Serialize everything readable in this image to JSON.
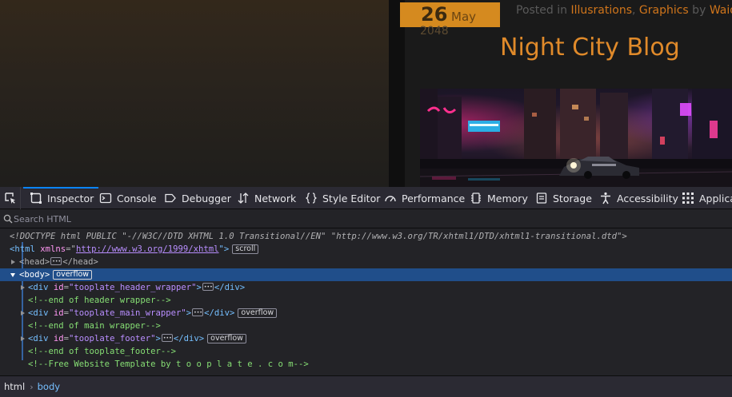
{
  "page": {
    "date_day": "26",
    "date_month": "May",
    "date_year": "2048",
    "meta_prefix": "Posted in ",
    "meta_cat1": "Illusrations",
    "meta_sep": ", ",
    "meta_cat2": "Graphics",
    "meta_by": " by ",
    "meta_author": "Waidroc",
    "blog_title": "Night City Blog",
    "hero_image_alt": "cyberpunk night city street with car and neon signs"
  },
  "devtools": {
    "tabs": [
      {
        "label": "Inspector",
        "icon": "inspector-icon",
        "active": true
      },
      {
        "label": "Console",
        "icon": "console-icon"
      },
      {
        "label": "Debugger",
        "icon": "debugger-icon"
      },
      {
        "label": "Network",
        "icon": "network-icon"
      },
      {
        "label": "Style Editor",
        "icon": "style-editor-icon"
      },
      {
        "label": "Performance",
        "icon": "performance-icon"
      },
      {
        "label": "Memory",
        "icon": "memory-icon"
      },
      {
        "label": "Storage",
        "icon": "storage-icon"
      },
      {
        "label": "Accessibility",
        "icon": "accessibility-icon"
      },
      {
        "label": "Applica",
        "icon": "application-icon"
      }
    ],
    "search_placeholder": "Search HTML",
    "markup": {
      "doctype": "<!DOCTYPE html PUBLIC \"-//W3C//DTD XHTML 1.0 Transitional//EN\" \"http://www.w3.org/TR/xhtml1/DTD/xhtml1-transitional.dtd\">",
      "html_open": "<html ",
      "html_attr": "xmlns",
      "html_eq": "=\"",
      "html_val": "http://www.w3.org/1999/xhtml",
      "html_close": "\">",
      "html_badge": "scroll",
      "head_open": "<head>",
      "head_close": "</head>",
      "body_tag": "<body>",
      "body_badge": "overflow",
      "div_open": "<div ",
      "id_attr": "id",
      "div1_id": "\"tooplate_header_wrapper\"",
      "gt": ">",
      "div_close": "</div>",
      "comment1": "<!--end of header wrapper-->",
      "div2_id": "\"tooplate_main_wrapper\"",
      "div2_badge": "overflow",
      "comment2": "<!--end of main wrapper-->",
      "div3_id": "\"tooplate_footer\"",
      "div3_badge": "overflow",
      "comment3": "<!--end of tooplate_footer-->",
      "comment4": "<!--Free Website Template by t o o p l a t e . c o m-->"
    },
    "breadcrumbs": [
      "html",
      "body"
    ]
  }
}
